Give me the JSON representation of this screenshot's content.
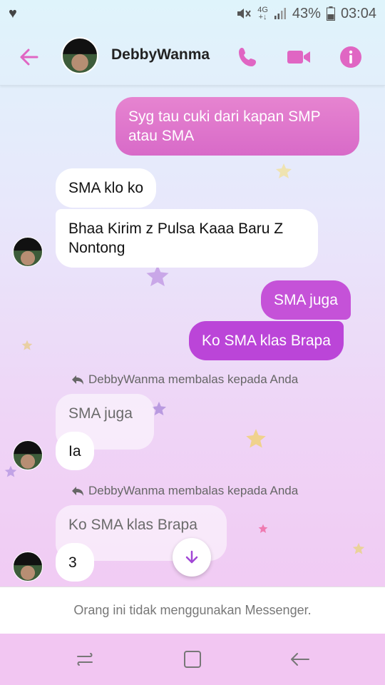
{
  "status_bar": {
    "network_top": "4G",
    "network_bottom": "+↓",
    "battery": "43%",
    "time": "03:04"
  },
  "header": {
    "contact_name": "DebbyWanma",
    "accent_color": "#e066c3"
  },
  "messages": [
    {
      "type": "sent",
      "text": "Syg tau cuki dari kapan SMP atau SMA"
    },
    {
      "type": "received",
      "text": "SMA klo ko"
    },
    {
      "type": "received",
      "text": "Bhaa Kirim z Pulsa Kaaa Baru Z Nontong"
    },
    {
      "type": "sent",
      "text": "SMA juga"
    },
    {
      "type": "sent",
      "text": "Ko SMA klas Brapa"
    },
    {
      "type": "reply_note",
      "text": "DebbyWanma membalas kepada Anda"
    },
    {
      "type": "quoted",
      "text": "SMA juga"
    },
    {
      "type": "received",
      "text": "Ia"
    },
    {
      "type": "reply_note",
      "text": "DebbyWanma membalas kepada Anda"
    },
    {
      "type": "quoted",
      "text": "Ko SMA klas Brapa"
    },
    {
      "type": "received",
      "text": "3"
    }
  ],
  "footer": {
    "note": "Orang ini tidak menggunakan Messenger."
  },
  "colors": {
    "sent_bubble_top": "#e47ad1",
    "sent_bubble_bottom": "#bb45d8",
    "icon_pink": "#e066c3"
  }
}
